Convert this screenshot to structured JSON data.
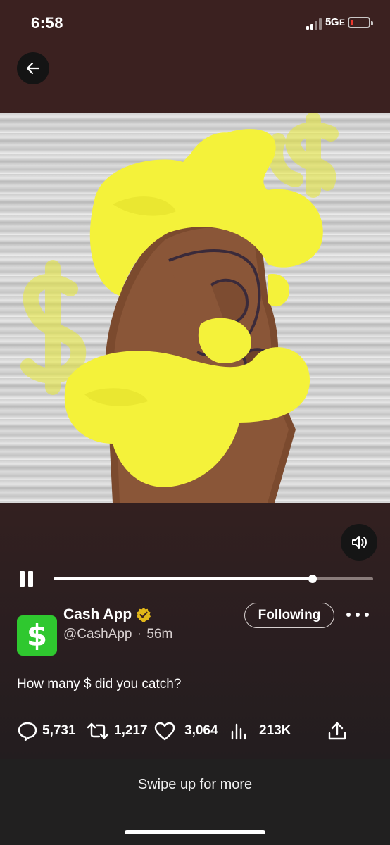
{
  "status_bar": {
    "time": "6:58",
    "network": "5G",
    "network_suffix": "E",
    "battery_level": 0.1
  },
  "video": {
    "playback_progress": 0.81,
    "state": "playing"
  },
  "author": {
    "name": "Cash App",
    "verified": true,
    "handle": "@CashApp",
    "separator": "·",
    "time_ago": "56m",
    "avatar_symbol": "$",
    "avatar_color": "#2fc82f",
    "follow_label": "Following"
  },
  "tweet": {
    "text": "How many $ did you catch?"
  },
  "metrics": {
    "replies": "5,731",
    "retweets": "1,217",
    "likes": "3,064",
    "views": "213K"
  },
  "footer": {
    "swipe_hint": "Swipe up for more"
  },
  "icons": {
    "back": "arrow-left-icon",
    "volume": "speaker-volume-icon",
    "pause": "pause-icon",
    "more": "more-dots-icon",
    "reply": "reply-bubble-icon",
    "retweet": "retweet-icon",
    "like": "heart-icon",
    "views": "bar-chart-icon",
    "share": "share-upload-icon",
    "verified": "verified-badge-icon"
  },
  "colors": {
    "background": "#3b2120",
    "verified_badge": "#e2b719",
    "avatar": "#2fc82f"
  }
}
